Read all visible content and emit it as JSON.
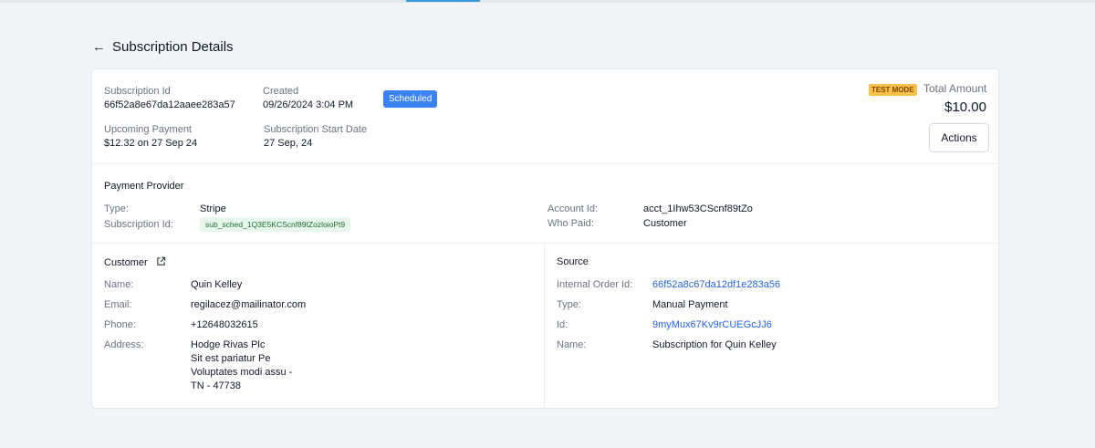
{
  "page": {
    "title": "Subscription Details",
    "back_icon": "arrow-left-icon"
  },
  "summary": {
    "subscription_id_label": "Subscription Id",
    "subscription_id": "66f52a8e67da12aaee283a57",
    "created_label": "Created",
    "created": "09/26/2024 3:04 PM",
    "status": "Scheduled",
    "upcoming_label": "Upcoming Payment",
    "upcoming": "$12.32 on 27 Sep 24",
    "start_date_label": "Subscription Start Date",
    "start_date": "27 Sep, 24",
    "test_mode": "TEST MODE",
    "total_label": "Total Amount",
    "total": "$10.00",
    "actions_label": "Actions"
  },
  "provider": {
    "title": "Payment Provider",
    "type_label": "Type:",
    "type": "Stripe",
    "sub_id_label": "Subscription Id:",
    "sub_id": "sub_sched_1Q3E5KCScnf89tZozloioPt9",
    "account_label": "Account Id:",
    "account": "acct_1Ihw53CScnf89tZo",
    "who_paid_label": "Who Paid:",
    "who_paid": "Customer"
  },
  "customer": {
    "title": "Customer",
    "link_icon": "external-link-icon",
    "name_label": "Name:",
    "name": "Quin Kelley",
    "email_label": "Email:",
    "email": "regilacez@mailinator.com",
    "phone_label": "Phone:",
    "phone": "+12648032615",
    "address_label": "Address:",
    "address": [
      "Hodge Rivas Plc",
      "Sit est pariatur Pe",
      "Voluptates modi assu -",
      "TN - 47738"
    ]
  },
  "source": {
    "title": "Source",
    "order_label": "Internal Order Id:",
    "order": "66f52a8c67da12df1e283a56",
    "type_label": "Type:",
    "type": "Manual Payment",
    "id_label": "Id:",
    "id": "9myMux67Kv9rCUEGcJJ6",
    "name_label": "Name:",
    "name": "Subscription for Quin Kelley"
  },
  "colors": {
    "accent": "#3b82f6",
    "link": "#2563eb",
    "test_badge": "#fbbf4a",
    "chip_bg": "#e8f7ec"
  }
}
